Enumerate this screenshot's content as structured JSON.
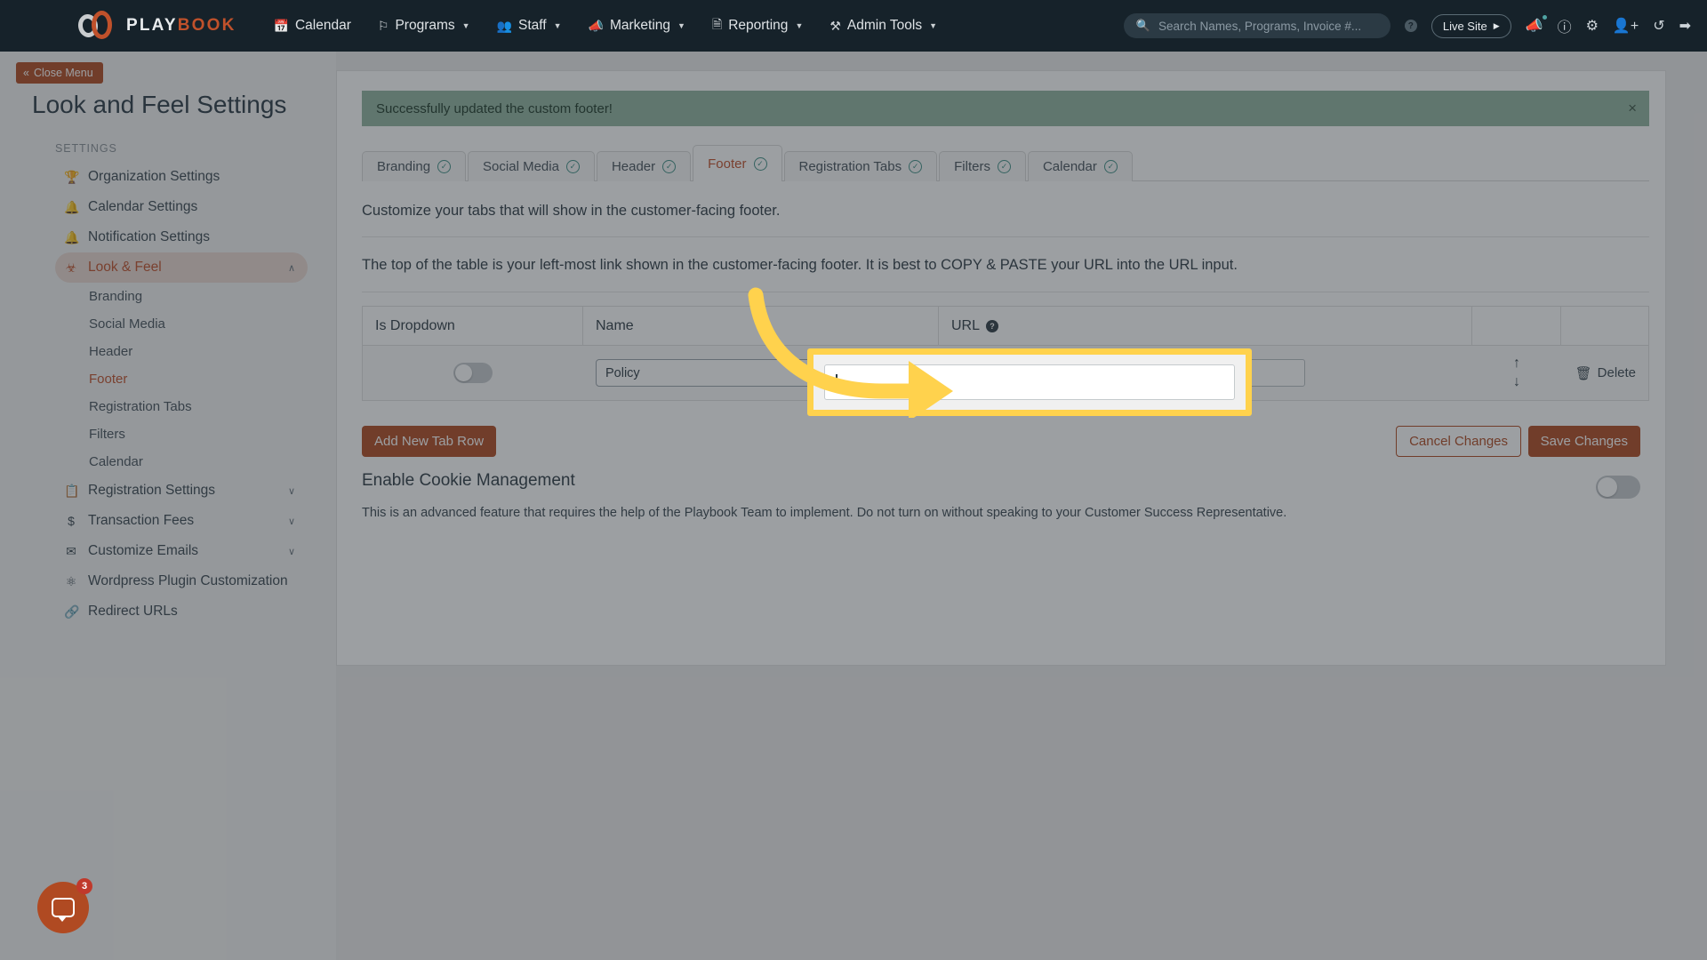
{
  "topnav": {
    "brand": {
      "word1": "PLAY",
      "word2": "BOOK"
    },
    "items": [
      {
        "label": "Calendar",
        "icon": "calendar-icon",
        "caret": false
      },
      {
        "label": "Programs",
        "icon": "flag-icon",
        "caret": true
      },
      {
        "label": "Staff",
        "icon": "users-icon",
        "caret": true
      },
      {
        "label": "Marketing",
        "icon": "megaphone-icon",
        "caret": true
      },
      {
        "label": "Reporting",
        "icon": "document-icon",
        "caret": true
      },
      {
        "label": "Admin Tools",
        "icon": "tools-icon",
        "caret": true
      }
    ],
    "search_placeholder": "Search Names, Programs, Invoice #...",
    "help_badge": "?",
    "live_site_label": "Live Site",
    "right_icons": [
      "megaphone-icon",
      "help-circle-icon",
      "gear-icon",
      "add-user-icon",
      "history-icon",
      "logout-icon"
    ]
  },
  "sidebar": {
    "close_menu_label": "Close Menu",
    "page_title": "Look and Feel Settings",
    "section_label": "SETTINGS",
    "items": [
      {
        "label": "Organization Settings",
        "icon": "trophy-icon",
        "active": false,
        "chevron": ""
      },
      {
        "label": "Calendar Settings",
        "icon": "bell-icon",
        "active": false,
        "chevron": ""
      },
      {
        "label": "Notification Settings",
        "icon": "bell-icon",
        "active": false,
        "chevron": ""
      },
      {
        "label": "Look & Feel",
        "icon": "balloon-icon",
        "active": true,
        "chevron": "∧"
      }
    ],
    "sub_items": [
      {
        "label": "Branding",
        "active": false
      },
      {
        "label": "Social Media",
        "active": false
      },
      {
        "label": "Header",
        "active": false
      },
      {
        "label": "Footer",
        "active": true
      },
      {
        "label": "Registration Tabs",
        "active": false
      },
      {
        "label": "Filters",
        "active": false
      },
      {
        "label": "Calendar",
        "active": false
      }
    ],
    "items_bottom": [
      {
        "label": "Registration Settings",
        "icon": "form-icon",
        "chevron": "∨"
      },
      {
        "label": "Transaction Fees",
        "icon": "dollar-icon",
        "chevron": "∨"
      },
      {
        "label": "Customize Emails",
        "icon": "envelope-icon",
        "chevron": "∨"
      },
      {
        "label": "Wordpress Plugin Customization",
        "icon": "wordpress-icon",
        "chevron": ""
      },
      {
        "label": "Redirect URLs",
        "icon": "link-icon",
        "chevron": ""
      }
    ]
  },
  "main": {
    "alert": {
      "message": "Successfully updated the custom footer!",
      "close": "×"
    },
    "tabs": [
      {
        "label": "Branding",
        "checked": true,
        "active": false
      },
      {
        "label": "Social Media",
        "checked": true,
        "active": false
      },
      {
        "label": "Header",
        "checked": true,
        "active": false
      },
      {
        "label": "Footer",
        "checked": true,
        "active": true
      },
      {
        "label": "Registration Tabs",
        "checked": true,
        "active": false
      },
      {
        "label": "Filters",
        "checked": true,
        "active": false
      },
      {
        "label": "Calendar",
        "checked": true,
        "active": false
      }
    ],
    "description_1": "Customize your tabs that will show in the customer-facing footer.",
    "description_2": "The top of the table is your left-most link shown in the customer-facing footer. It is best to COPY & PASTE your URL into the URL input.",
    "table": {
      "headers": [
        "Is Dropdown",
        "Name",
        "URL",
        "",
        ""
      ],
      "url_help_badge": "?",
      "rows": [
        {
          "is_dropdown": false,
          "name_value": "Policy",
          "url_value": "",
          "url_placeholder": "",
          "move_up": "↑",
          "move_down": "↓",
          "delete_label": "Delete",
          "delete_icon": "trash-icon"
        }
      ]
    },
    "buttons": {
      "add_row": "Add New Tab Row",
      "cancel": "Cancel Changes",
      "save": "Save Changes"
    },
    "cookie": {
      "title": "Enable Cookie Management",
      "text": "This is an advanced feature that requires the help of the Playbook Team to implement. Do not turn on without speaking to your Customer Success Representative.",
      "enabled": false
    }
  },
  "chat": {
    "badge": "3",
    "icon": "chat-bubble-icon"
  },
  "colors": {
    "brand_orange": "#c0512b",
    "nav_dark": "#16222a",
    "highlight_yellow": "#ffd24d",
    "success_green": "#91b39f",
    "check_teal": "#3f8f85"
  }
}
